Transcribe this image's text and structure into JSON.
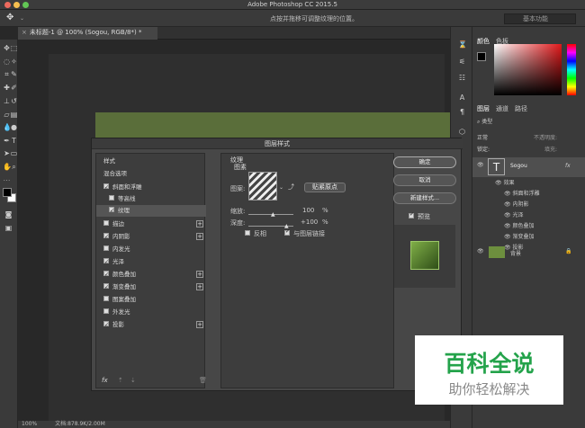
{
  "app_title": "Adobe Photoshop CC 2015.5",
  "options_hint": "点按并拖移可调整纹理的位置。",
  "workspace": "基本功能",
  "doc_tab": "未标题-1 @ 100% (Sogou, RGB/8*) *",
  "status": {
    "zoom": "100%",
    "doc": "文档:878.9K/2.00M"
  },
  "panels": {
    "color_tabs": [
      "颜色",
      "色板"
    ],
    "layer_tabs": [
      "图层",
      "通道",
      "路径"
    ],
    "kind_label": "类型",
    "normal_label": "正常",
    "opacity_label": "不透明度:",
    "lock_label": "锁定:",
    "fill_label": "填充:",
    "layer_text": "Sogou",
    "effects_label": "效果",
    "effects": [
      "斜面和浮雕",
      "内阴影",
      "光泽",
      "颜色叠加",
      "渐变叠加",
      "投影"
    ],
    "bg_layer": "背景"
  },
  "dialog": {
    "title": "图层样式",
    "styles_header": "样式",
    "blend_options": "混合选项",
    "items": [
      {
        "label": "斜面和浮雕",
        "checked": true,
        "plus": false,
        "indent": false
      },
      {
        "label": "等高线",
        "checked": false,
        "plus": false,
        "indent": true
      },
      {
        "label": "纹理",
        "checked": true,
        "plus": false,
        "indent": true
      },
      {
        "label": "描边",
        "checked": false,
        "plus": true,
        "indent": false
      },
      {
        "label": "内阴影",
        "checked": true,
        "plus": true,
        "indent": false
      },
      {
        "label": "内发光",
        "checked": false,
        "plus": false,
        "indent": false
      },
      {
        "label": "光泽",
        "checked": true,
        "plus": false,
        "indent": false
      },
      {
        "label": "颜色叠加",
        "checked": true,
        "plus": true,
        "indent": false
      },
      {
        "label": "渐变叠加",
        "checked": true,
        "plus": true,
        "indent": false
      },
      {
        "label": "图案叠加",
        "checked": false,
        "plus": false,
        "indent": false
      },
      {
        "label": "外发光",
        "checked": false,
        "plus": false,
        "indent": false
      },
      {
        "label": "投影",
        "checked": true,
        "plus": true,
        "indent": false
      }
    ],
    "section_title": "纹理",
    "section_sub": "图素",
    "pattern_label": "图案:",
    "snap_button": "贴紧原点",
    "scale_label": "缩放:",
    "scale_value": "100",
    "depth_label": "深度:",
    "depth_value": "+100",
    "pct": "%",
    "invert_label": "反相",
    "link_label": "与图层链接",
    "ok": "确定",
    "cancel": "取消",
    "new_style": "新建样式...",
    "preview_label": "预览",
    "fx_label": "fx"
  },
  "watermark": {
    "main": "百科全说",
    "sub": "助你轻松解决"
  }
}
